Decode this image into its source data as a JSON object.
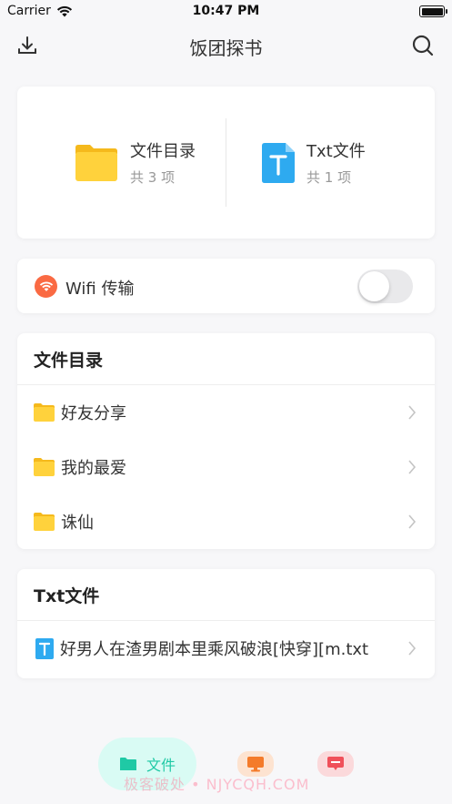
{
  "status": {
    "carrier": "Carrier",
    "time": "10:47 PM"
  },
  "nav": {
    "title": "饭团探书",
    "left_icon": "download-icon",
    "right_icon": "search-icon"
  },
  "summary": {
    "folder": {
      "name": "文件目录",
      "count": "共 3 项"
    },
    "txt": {
      "name": "Txt文件",
      "count": "共 1 项"
    }
  },
  "wifi": {
    "label": "Wifi 传输",
    "enabled": false
  },
  "folders": {
    "header": "文件目录",
    "items": [
      {
        "label": "好友分享"
      },
      {
        "label": "我的最爱"
      },
      {
        "label": "诛仙"
      }
    ]
  },
  "txt_files": {
    "header": "Txt文件",
    "items": [
      {
        "label": "好男人在渣男剧本里乘风破浪[快穿][m.txt"
      }
    ]
  },
  "tabs": {
    "active_label": "文件",
    "watermark": "极客破处 • NJYCQH.COM"
  },
  "colors": {
    "accent": "#1fc9a5",
    "folder": "#ffd23c",
    "txt": "#2eaaf0",
    "wifi": "#fa6a43"
  }
}
